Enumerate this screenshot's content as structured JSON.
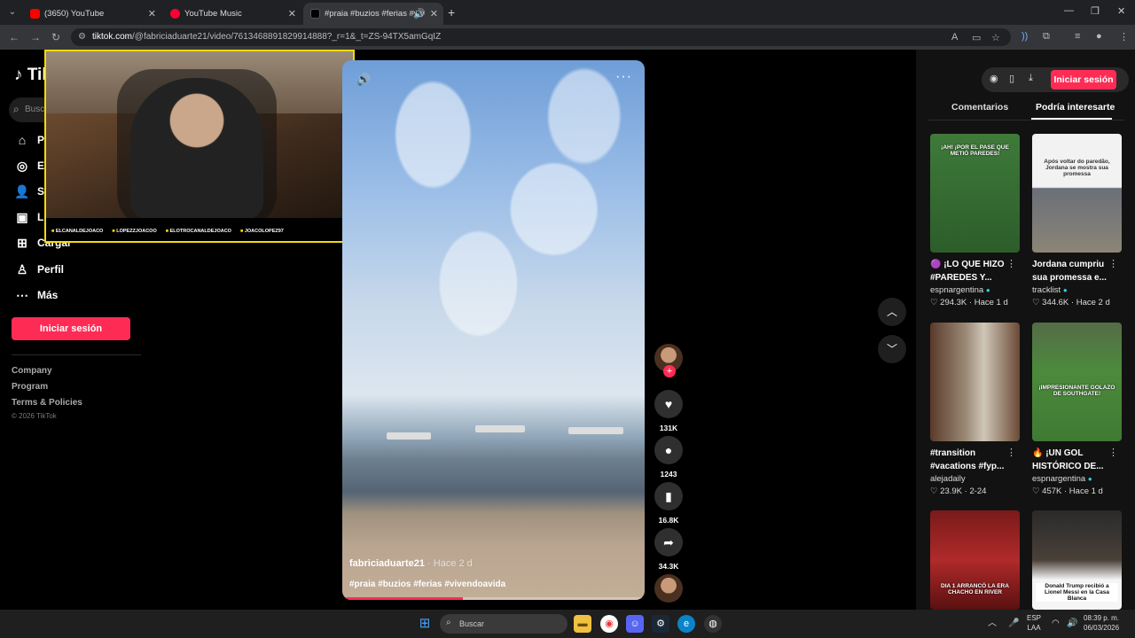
{
  "browser": {
    "tabs": [
      {
        "title": "(3650) YouTube",
        "color": "#ff0000"
      },
      {
        "title": "YouTube Music",
        "color": "#ff0033"
      },
      {
        "title": "#praia #buzios #ferias #viv",
        "color": "#000000"
      }
    ],
    "url_host": "tiktok.com",
    "url_path": "/@fabriciaduarte21/video/7613468891829914888?_r=1&_t=ZS-94TX5amGqIZ"
  },
  "sidebar": {
    "logo": "TikTok",
    "search_placeholder": "Busc",
    "items": [
      {
        "icon": "home-icon",
        "label": "P"
      },
      {
        "icon": "explore-icon",
        "label": "E"
      },
      {
        "icon": "following-icon",
        "label": "S"
      },
      {
        "icon": "live-icon",
        "label": "L"
      },
      {
        "icon": "upload-icon",
        "label": "Cargar"
      },
      {
        "icon": "profile-icon",
        "label": "Perfil"
      },
      {
        "icon": "more-icon",
        "label": "Más"
      }
    ],
    "login_label": "Iniciar sesión",
    "footer_links": [
      "Company",
      "Program",
      "Terms & Policies"
    ],
    "copyright": "© 2026 TikTok"
  },
  "webcam": {
    "socials": [
      "ELCANALDEJOACO",
      "LOPEZZJOACOO",
      "ELOTROCANALDEJOACO",
      "JOACOLOPEZ97"
    ]
  },
  "video": {
    "author": "fabriciaduarte21",
    "time": "· Hace 2 d",
    "tags": "#praia #buzios #ferias #vivendoavida",
    "progress": 0.4,
    "likes": "131K",
    "comments": "1243",
    "saves": "16.8K",
    "shares": "34.3K"
  },
  "right_panel": {
    "login_label": "Iniciar sesión",
    "tabs": [
      "Comentarios",
      "Podría interesarte"
    ],
    "cards": [
      {
        "thumb_caption": "¡AH! ¡POR EL PASE QUE METIÓ PAREDES!",
        "title": "🟣 ¡LO QUE HIZO #PAREDES Y...",
        "user": "espnargentina",
        "verified": true,
        "likes": "294.3K",
        "time": "Hace 1 d"
      },
      {
        "thumb_caption": "Após voltar do paredão, Jordana se mostra sua promessa",
        "title": "Jordana cumpriu sua promessa e...",
        "user": "tracklist",
        "verified": true,
        "likes": "344.6K",
        "time": "Hace 2 d"
      },
      {
        "thumb_caption": "",
        "title": "#transition #vacations #fyp...",
        "user": "alejadaily",
        "verified": false,
        "likes": "23.9K",
        "time": "2-24"
      },
      {
        "thumb_caption": "¡IMPRESIONANTE GOLAZO DE SOUTHGATE!",
        "title": "🔥 ¡UN GOL HISTÓRICO DE...",
        "user": "espnargentina",
        "verified": true,
        "likes": "457K",
        "time": "Hace 1 d"
      },
      {
        "thumb_caption": "DIA 1 ARRANCÓ LA ERA CHACHO EN RIVER",
        "title": "",
        "user": "",
        "verified": false,
        "likes": "",
        "time": ""
      },
      {
        "thumb_caption": "Donald Trump recibió a Lionel Messi en la Casa Blanca",
        "title": "",
        "user": "",
        "verified": false,
        "likes": "",
        "time": ""
      }
    ]
  },
  "taskbar": {
    "search_placeholder": "Buscar",
    "lang": "ESP",
    "region": "LAA",
    "time": "08:39 p. m.",
    "date": "06/03/2026"
  }
}
